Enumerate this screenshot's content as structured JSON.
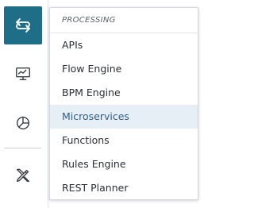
{
  "rail": {
    "items": [
      {
        "icon": "swap-arrows-icon",
        "active": true
      },
      {
        "icon": "monitor-chart-icon",
        "active": false
      },
      {
        "icon": "pie-chart-icon",
        "active": false
      },
      {
        "icon": "design-tools-icon",
        "active": false
      }
    ]
  },
  "menu": {
    "header": "PROCESSING",
    "items": [
      {
        "label": "APIs"
      },
      {
        "label": "Flow Engine"
      },
      {
        "label": "BPM Engine"
      },
      {
        "label": "Microservices",
        "highlighted": true
      },
      {
        "label": "Functions"
      },
      {
        "label": "Rules Engine"
      },
      {
        "label": "REST Planner"
      }
    ]
  },
  "colors": {
    "accent": "#1d6e86",
    "highlight_bg": "#e6eef6",
    "highlight_text": "#2f5f85",
    "text": "#2b2f33",
    "icon": "#3a3f45"
  }
}
